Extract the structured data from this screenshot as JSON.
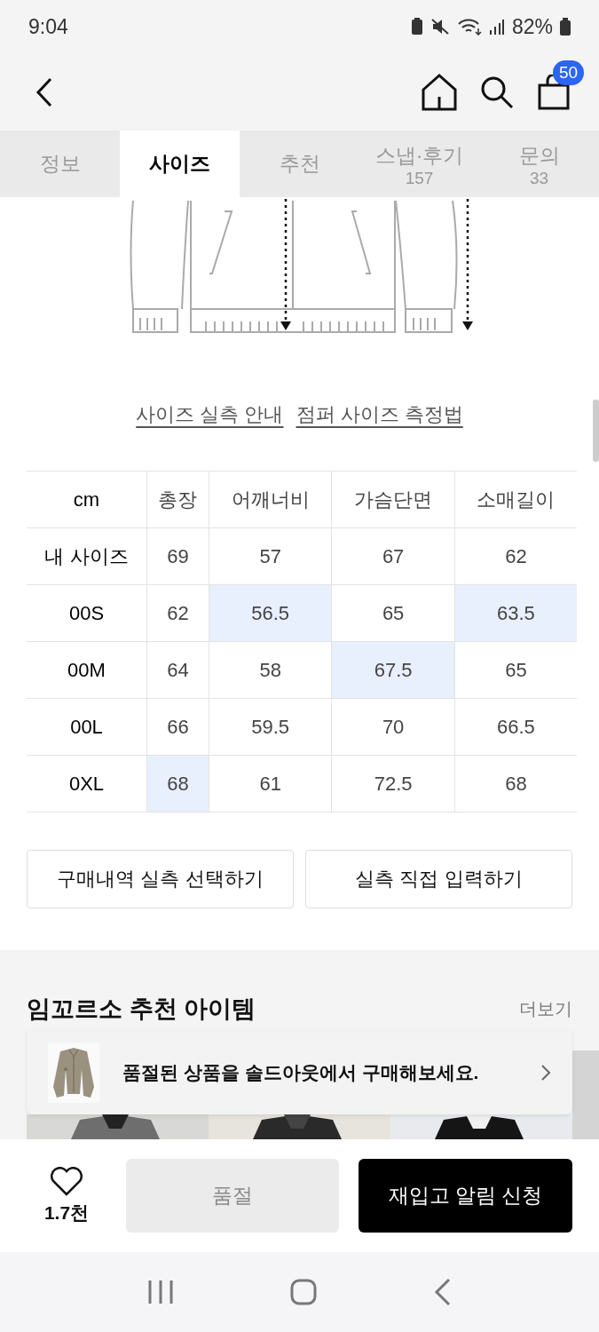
{
  "status_bar": {
    "time": "9:04",
    "battery": "82%"
  },
  "header": {
    "cart_count": "50"
  },
  "tabs": [
    {
      "label": "정보",
      "selected": false
    },
    {
      "label": "사이즈",
      "selected": true
    },
    {
      "label": "추천",
      "selected": false
    },
    {
      "label": "스냅·후기",
      "count": "157",
      "selected": false
    },
    {
      "label": "문의",
      "count": "33",
      "selected": false
    }
  ],
  "size_links": [
    "사이즈 실측 안내",
    "점퍼 사이즈 측정법"
  ],
  "size_table": {
    "columns": [
      "cm",
      "총장",
      "어깨너비",
      "가슴단면",
      "소매길이"
    ],
    "rows": [
      {
        "cells": [
          {
            "text": "내 사이즈",
            "highlighted": false
          },
          {
            "text": "69",
            "highlighted": false
          },
          {
            "text": "57",
            "highlighted": false
          },
          {
            "text": "67",
            "highlighted": false
          },
          {
            "text": "62",
            "highlighted": false
          }
        ]
      },
      {
        "cells": [
          {
            "text": "00S",
            "highlighted": false
          },
          {
            "text": "62",
            "highlighted": false
          },
          {
            "text": "56.5",
            "highlighted": true
          },
          {
            "text": "65",
            "highlighted": false
          },
          {
            "text": "63.5",
            "highlighted": true
          }
        ]
      },
      {
        "cells": [
          {
            "text": "00M",
            "highlighted": false
          },
          {
            "text": "64",
            "highlighted": false
          },
          {
            "text": "58",
            "highlighted": false
          },
          {
            "text": "67.5",
            "highlighted": true
          },
          {
            "text": "65",
            "highlighted": false
          }
        ]
      },
      {
        "cells": [
          {
            "text": "00L",
            "highlighted": false
          },
          {
            "text": "66",
            "highlighted": false
          },
          {
            "text": "59.5",
            "highlighted": false
          },
          {
            "text": "70",
            "highlighted": false
          },
          {
            "text": "66.5",
            "highlighted": false
          }
        ]
      },
      {
        "cells": [
          {
            "text": "0XL",
            "highlighted": false
          },
          {
            "text": "68",
            "highlighted": true
          },
          {
            "text": "61",
            "highlighted": false
          },
          {
            "text": "72.5",
            "highlighted": false
          },
          {
            "text": "68",
            "highlighted": false
          }
        ]
      }
    ]
  },
  "size_buttons": [
    "구매내역 실측 선택하기",
    "실측 직접 입력하기"
  ],
  "recommend": {
    "title": "임꼬르소 추천 아이템",
    "more": "더보기"
  },
  "soldout_banner": {
    "text": "품절된 상품을 솔드아웃에서 구매해보세요."
  },
  "bottom_bar": {
    "likes": "1.7천",
    "soldout_button": "품절",
    "restock_button": "재입고 알림 신청"
  }
}
